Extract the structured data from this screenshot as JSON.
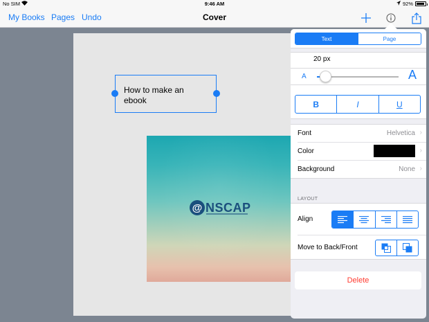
{
  "status_bar": {
    "carrier": "No SIM",
    "time": "9:46 AM",
    "battery": "92%",
    "battery_level": 0.92
  },
  "nav": {
    "my_books": "My Books",
    "pages": "Pages",
    "undo": "Undo",
    "title": "Cover"
  },
  "canvas": {
    "text_box": "How to make an ebook",
    "logo_at": "@",
    "logo_word": "NSCAP"
  },
  "inspector": {
    "tabs": [
      {
        "label": "Text",
        "selected": true
      },
      {
        "label": "Page",
        "selected": false
      }
    ],
    "font_size": "20 px",
    "font_size_slider": 0.1,
    "size_small_label": "A",
    "size_large_label": "A",
    "style_buttons": {
      "bold": "B",
      "italic": "I",
      "underline": "U"
    },
    "rows": {
      "font": {
        "label": "Font",
        "value": "Helvetica"
      },
      "color": {
        "label": "Color",
        "swatch": "#000000"
      },
      "background": {
        "label": "Background",
        "value": "None"
      }
    },
    "layout_header": "LAYOUT",
    "align_label": "Align",
    "align_selected": "left",
    "move_label": "Move to Back/Front",
    "delete_label": "Delete"
  },
  "colors": {
    "accent": "#1a7cf5",
    "destructive": "#ff3b30"
  }
}
